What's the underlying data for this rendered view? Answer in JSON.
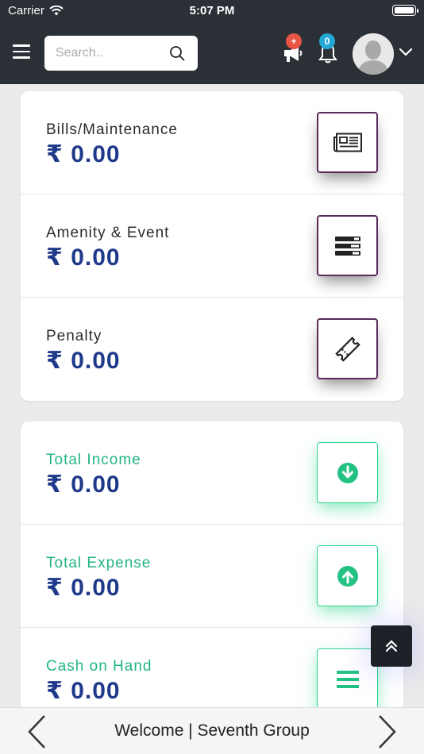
{
  "status_bar": {
    "carrier": "Carrier",
    "time": "5:07 PM"
  },
  "header": {
    "search_placeholder": "Search..",
    "announcement_badge": "+",
    "notification_badge": "0"
  },
  "summary_card": {
    "rows": [
      {
        "label": "Bills/Maintenance",
        "amount": "₹ 0.00",
        "icon": "newspaper-icon"
      },
      {
        "label": "Amenity & Event",
        "amount": "₹ 0.00",
        "icon": "server-list-icon"
      },
      {
        "label": "Penalty",
        "amount": "₹ 0.00",
        "icon": "ticket-icon"
      }
    ]
  },
  "finance_card": {
    "rows": [
      {
        "label": "Total Income",
        "amount": "₹ 0.00",
        "icon": "arrow-down-circle-icon"
      },
      {
        "label": "Total Expense",
        "amount": "₹ 0.00",
        "icon": "arrow-up-circle-icon"
      },
      {
        "label": "Cash on Hand",
        "amount": "₹ 0.00",
        "icon": "bars-icon"
      }
    ]
  },
  "footer": {
    "title": "Welcome | Seventh Group"
  },
  "colors": {
    "header_bg": "#2b2f36",
    "amount": "#1f3a8a",
    "green_accent": "#23b680",
    "purple_border": "#5a2a5a",
    "badge_red": "#e85545",
    "badge_blue": "#22a9d6"
  }
}
